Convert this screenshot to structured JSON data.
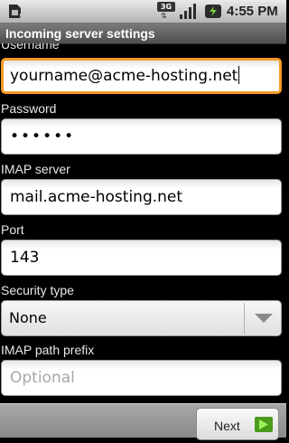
{
  "status_bar": {
    "time": "4:55 PM",
    "network_label": "3G",
    "icons": [
      "sim-card-icon",
      "3g-data-icon",
      "signal-strength-icon",
      "battery-charging-icon"
    ]
  },
  "title_bar": {
    "title": "Incoming server settings"
  },
  "form": {
    "username": {
      "label": "Username",
      "value": "yourname@acme-hosting.net",
      "focused": true
    },
    "password": {
      "label": "Password",
      "value": "••••••"
    },
    "imap_server": {
      "label": "IMAP server",
      "value": "mail.acme-hosting.net"
    },
    "port": {
      "label": "Port",
      "value": "143"
    },
    "security_type": {
      "label": "Security type",
      "selected": "None"
    },
    "imap_path_prefix": {
      "label": "IMAP path prefix",
      "placeholder": "Optional"
    }
  },
  "bottom_bar": {
    "next_label": "Next"
  },
  "colors": {
    "focus_border": "#f59a24",
    "next_arrow": "#6fcf2a",
    "background": "#000000"
  }
}
